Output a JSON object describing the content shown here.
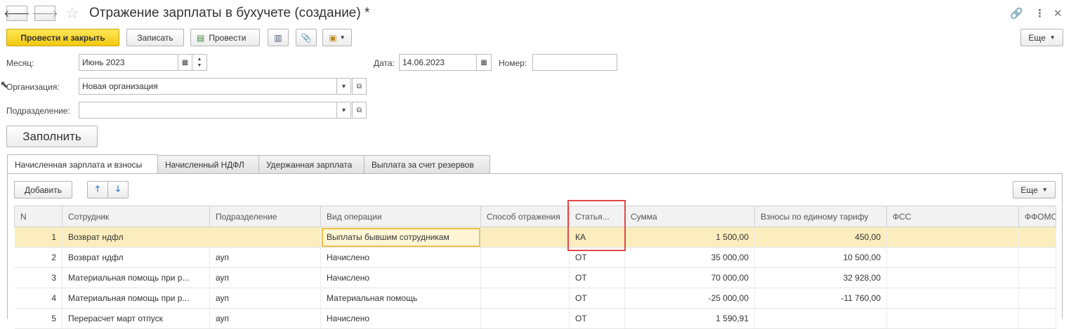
{
  "window": {
    "title": "Отражение зарплаты в бухучете (создание) *"
  },
  "toolbar": {
    "post_close": "Провести и закрыть",
    "save": "Записать",
    "post": "Провести",
    "more": "Еще"
  },
  "form": {
    "month_label": "Месяц:",
    "month_value": "Июнь 2023",
    "date_label": "Дата:",
    "date_value": "14.06.2023",
    "number_label": "Номер:",
    "number_value": "",
    "org_label": "Организация:",
    "org_value": "Новая организация",
    "dept_label": "Подразделение:",
    "dept_value": "",
    "fill_button": "Заполнить"
  },
  "tabs": [
    {
      "label": "Начисленная зарплата и взносы",
      "active": true
    },
    {
      "label": "Начисленный НДФЛ",
      "active": false
    },
    {
      "label": "Удержанная зарплата",
      "active": false
    },
    {
      "label": "Выплата за счет резервов",
      "active": false
    }
  ],
  "table_toolbar": {
    "add": "Добавить",
    "more": "Еще"
  },
  "table": {
    "columns": [
      "N",
      "Сотрудник",
      "Подразделение",
      "Вид операции",
      "Способ отражения",
      "Статья...",
      "Сумма",
      "Взносы по единому тарифу",
      "ФСС",
      "ФФОМС"
    ],
    "rows": [
      [
        "1",
        "Возврат ндфл",
        "",
        "Выплаты бывшим сотрудникам",
        "",
        "КА",
        "1 500,00",
        "450,00",
        "",
        ""
      ],
      [
        "2",
        "Возврат ндфл",
        "ауп",
        "Начислено",
        "",
        "ОТ",
        "35 000,00",
        "10 500,00",
        "",
        ""
      ],
      [
        "3",
        "Материальная помощь при р...",
        "ауп",
        "Начислено",
        "",
        "ОТ",
        "70 000,00",
        "32 928,00",
        "",
        ""
      ],
      [
        "4",
        "Материальная помощь при р...",
        "ауп",
        "Материальная помощь",
        "",
        "ОТ",
        "-25 000,00",
        "-11 760,00",
        "",
        ""
      ],
      [
        "5",
        "Перерасчет март отпуск",
        "ауп",
        "Начислено",
        "",
        "ОТ",
        "1 590,91",
        "",
        "",
        ""
      ]
    ]
  },
  "icons": {
    "back": "arrow-left-icon",
    "forward": "arrow-right-icon",
    "favorite": "star-icon",
    "link": "link-icon",
    "menu": "kebab-menu-icon",
    "close": "close-icon"
  }
}
